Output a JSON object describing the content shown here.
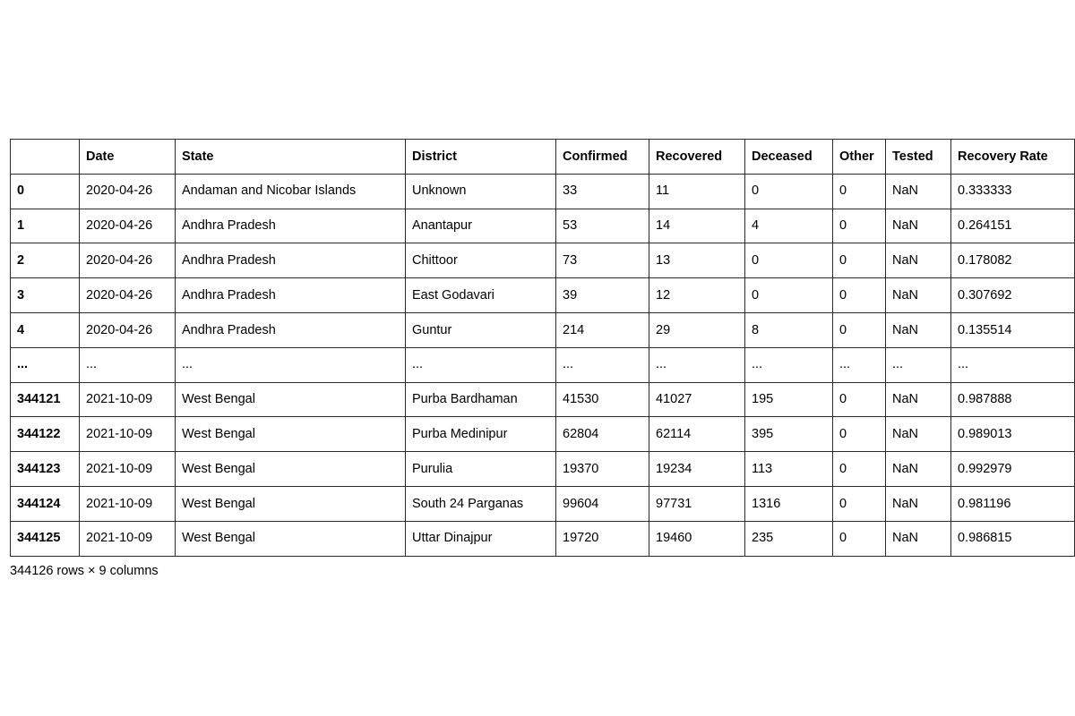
{
  "dataframe": {
    "index_header": "",
    "columns": [
      "Date",
      "State",
      "District",
      "Confirmed",
      "Recovered",
      "Deceased",
      "Other",
      "Tested",
      "Recovery Rate"
    ],
    "rows": [
      {
        "index": "0",
        "cells": [
          "2020-04-26",
          "Andaman and Nicobar Islands",
          "Unknown",
          "33",
          "11",
          "0",
          "0",
          "NaN",
          "0.333333"
        ]
      },
      {
        "index": "1",
        "cells": [
          "2020-04-26",
          "Andhra Pradesh",
          "Anantapur",
          "53",
          "14",
          "4",
          "0",
          "NaN",
          "0.264151"
        ]
      },
      {
        "index": "2",
        "cells": [
          "2020-04-26",
          "Andhra Pradesh",
          "Chittoor",
          "73",
          "13",
          "0",
          "0",
          "NaN",
          "0.178082"
        ]
      },
      {
        "index": "3",
        "cells": [
          "2020-04-26",
          "Andhra Pradesh",
          "East Godavari",
          "39",
          "12",
          "0",
          "0",
          "NaN",
          "0.307692"
        ]
      },
      {
        "index": "4",
        "cells": [
          "2020-04-26",
          "Andhra Pradesh",
          "Guntur",
          "214",
          "29",
          "8",
          "0",
          "NaN",
          "0.135514"
        ]
      },
      {
        "index": "...",
        "cells": [
          "...",
          "...",
          "...",
          "...",
          "...",
          "...",
          "...",
          "...",
          "..."
        ]
      },
      {
        "index": "344121",
        "cells": [
          "2021-10-09",
          "West Bengal",
          "Purba Bardhaman",
          "41530",
          "41027",
          "195",
          "0",
          "NaN",
          "0.987888"
        ]
      },
      {
        "index": "344122",
        "cells": [
          "2021-10-09",
          "West Bengal",
          "Purba Medinipur",
          "62804",
          "62114",
          "395",
          "0",
          "NaN",
          "0.989013"
        ]
      },
      {
        "index": "344123",
        "cells": [
          "2021-10-09",
          "West Bengal",
          "Purulia",
          "19370",
          "19234",
          "113",
          "0",
          "NaN",
          "0.992979"
        ]
      },
      {
        "index": "344124",
        "cells": [
          "2021-10-09",
          "West Bengal",
          "South 24 Parganas",
          "99604",
          "97731",
          "1316",
          "0",
          "NaN",
          "0.981196"
        ]
      },
      {
        "index": "344125",
        "cells": [
          "2021-10-09",
          "West Bengal",
          "Uttar Dinajpur",
          "19720",
          "19460",
          "235",
          "0",
          "NaN",
          "0.986815"
        ]
      }
    ],
    "shape_caption": "344126 rows × 9 columns"
  },
  "style": {
    "border_color": "#2b2b2b",
    "text_color": "#000000",
    "background": "#ffffff"
  }
}
